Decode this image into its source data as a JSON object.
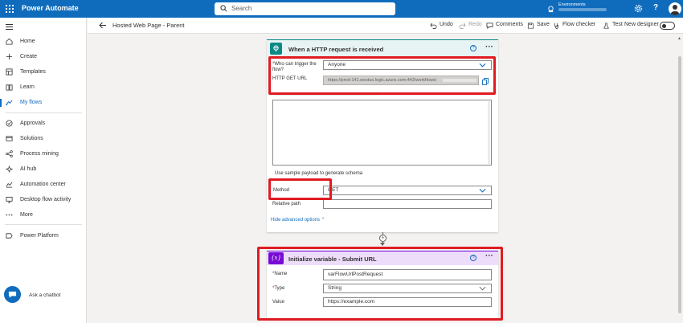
{
  "app": {
    "name": "Power Automate"
  },
  "search": {
    "placeholder": "Search"
  },
  "environment": {
    "label": "Environments"
  },
  "topbar": {
    "help": "?"
  },
  "sidebar": {
    "items": [
      {
        "label": "Home",
        "icon": "home-icon"
      },
      {
        "label": "Create",
        "icon": "plus-icon"
      },
      {
        "label": "Templates",
        "icon": "templates-icon"
      },
      {
        "label": "Learn",
        "icon": "book-icon"
      },
      {
        "label": "My flows",
        "icon": "flows-icon",
        "active": true
      },
      {
        "label": "Approvals",
        "icon": "approvals-icon"
      },
      {
        "label": "Solutions",
        "icon": "solutions-icon"
      },
      {
        "label": "Process mining",
        "icon": "process-mining-icon"
      },
      {
        "label": "AI hub",
        "icon": "ai-hub-icon"
      },
      {
        "label": "Automation center",
        "icon": "automation-center-icon"
      },
      {
        "label": "Desktop flow activity",
        "icon": "desktop-flow-icon"
      },
      {
        "label": "More",
        "icon": "more-icon"
      },
      {
        "label": "Power Platform",
        "icon": "power-platform-icon"
      }
    ],
    "chatbot_label": "Ask a chatbot"
  },
  "commandbar": {
    "flow_title": "Hosted Web Page - Parent",
    "undo": "Undo",
    "redo": "Redo",
    "comments": "Comments",
    "save": "Save",
    "flow_checker": "Flow checker",
    "test": "Test",
    "new_designer": "New designer"
  },
  "trigger_card": {
    "title": "When a HTTP request is received",
    "who_label": "Who can trigger the flow?",
    "who_value": "Anyone",
    "url_label": "HTTP GET URL",
    "url_value": "https://prod-141.westus.logic.azure.com:443/workflows/",
    "sample_link": "Use sample payload to generate schema",
    "method_label": "Method",
    "method_value": "GET",
    "relative_path_label": "Relative path",
    "advanced_link": "Hide advanced options"
  },
  "variable_card": {
    "title": "Initialize variable - Submit URL",
    "icon_text": "{x}",
    "name_label": "Name",
    "name_value": "varFlowUrlPostRequest",
    "type_label": "Type",
    "type_value": "String",
    "value_label": "Value",
    "value_value": "https://example.com"
  },
  "colors": {
    "brand": "#0f6cbd",
    "trigger_accent": "#0b8987",
    "variable_accent": "#770bd6",
    "highlight": "#e01b22"
  }
}
